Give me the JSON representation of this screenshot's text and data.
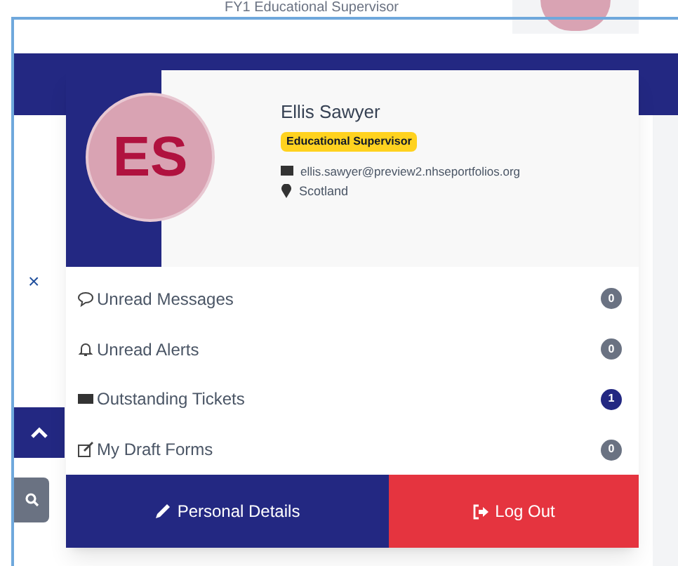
{
  "header": {
    "role_text": "FY1 Educational Supervisor"
  },
  "background": {
    "close_label": "×"
  },
  "profile": {
    "initials": "ES",
    "name": "Ellis Sawyer",
    "role_badge": "Educational Supervisor",
    "email": "ellis.sawyer@preview2.nhseportfolios.org",
    "location": "Scotland"
  },
  "menu_items": [
    {
      "kind": "messages",
      "label": "Unread Messages",
      "count": "0",
      "highlight": false
    },
    {
      "kind": "alerts",
      "label": "Unread Alerts",
      "count": "0",
      "highlight": false
    },
    {
      "kind": "tickets",
      "label": "Outstanding Tickets",
      "count": "1",
      "highlight": true
    },
    {
      "kind": "drafts",
      "label": "My Draft Forms",
      "count": "0",
      "highlight": false
    }
  ],
  "buttons": [
    {
      "kind": "details",
      "label": "Personal Details"
    },
    {
      "kind": "logout",
      "label": "Log Out"
    }
  ]
}
